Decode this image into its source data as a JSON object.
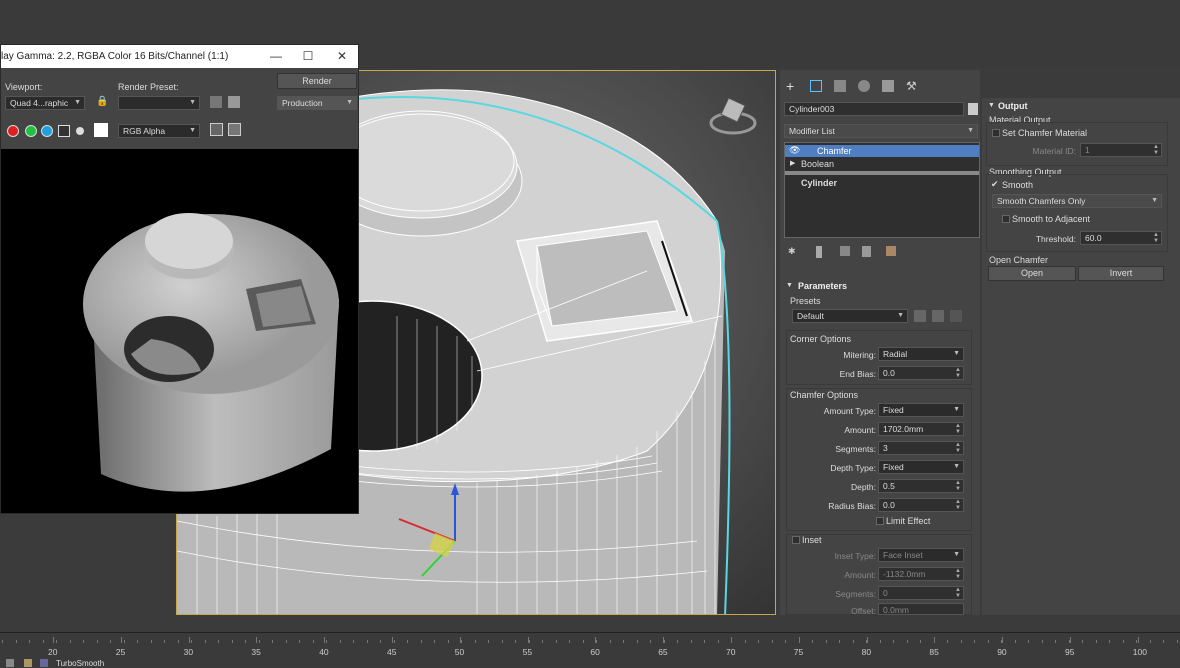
{
  "render_window": {
    "title": "lay Gamma: 2.2, RGBA Color 16 Bits/Channel (1:1)",
    "viewport_label": "Viewport:",
    "viewport_value": "Quad 4...raphic",
    "preset_label": "Render Preset:",
    "preset_value": "",
    "render_button": "Render",
    "production_value": "Production",
    "channel_value": "RGB Alpha"
  },
  "command_panel": {
    "object_name": "Cylinder003",
    "modifier_list": "Modifier List",
    "stack": [
      "Chamfer",
      "Boolean",
      "Cylinder"
    ],
    "parameters_title": "Parameters",
    "presets_label": "Presets",
    "presets_value": "Default",
    "corner_options": "Corner Options",
    "mitering_label": "Mitering:",
    "mitering_value": "Radial",
    "end_bias_label": "End Bias:",
    "end_bias_value": "0.0",
    "chamfer_options": "Chamfer Options",
    "amount_type_label": "Amount Type:",
    "amount_type_value": "Fixed",
    "amount_label": "Amount:",
    "amount_value": "1702.0mm",
    "segments_label": "Segments:",
    "segments_value": "3",
    "depth_type_label": "Depth Type:",
    "depth_type_value": "Fixed",
    "depth_label": "Depth:",
    "depth_value": "0.5",
    "radius_bias_label": "Radius Bias:",
    "radius_bias_value": "0.0",
    "limit_effect": "Limit Effect",
    "inset_label": "Inset",
    "inset_type_label": "Inset Type:",
    "inset_type_value": "Face Inset",
    "inset_amount_label": "Amount:",
    "inset_amount_value": "-1132.0mm",
    "inset_segments_label": "Segments:",
    "inset_segments_value": "0",
    "offset_label": "Offset:",
    "offset_value": "0.0mm"
  },
  "output_panel": {
    "title": "Output",
    "material_output": "Material Output",
    "set_chamfer_material": "Set Chamfer Material",
    "material_id_label": "Material ID:",
    "material_id_value": "1",
    "smoothing_output": "Smoothing Output",
    "smooth": "Smooth",
    "smooth_mode": "Smooth Chamfers Only",
    "smooth_to_adjacent": "Smooth to Adjacent",
    "threshold_label": "Threshold:",
    "threshold_value": "60.0",
    "open_chamfer": "Open Chamfer",
    "open_button": "Open",
    "invert_button": "Invert"
  },
  "timeline": {
    "ticks": [
      "20",
      "25",
      "30",
      "35",
      "40",
      "45",
      "50",
      "55",
      "60",
      "65",
      "70",
      "75",
      "80",
      "85",
      "90",
      "95",
      "100"
    ],
    "status": "TurboSmooth"
  },
  "colors": {
    "accent_blue": "#4f7fc2",
    "viewport_border": "#c9a64a",
    "selection_cyan": "#58d8e0"
  }
}
